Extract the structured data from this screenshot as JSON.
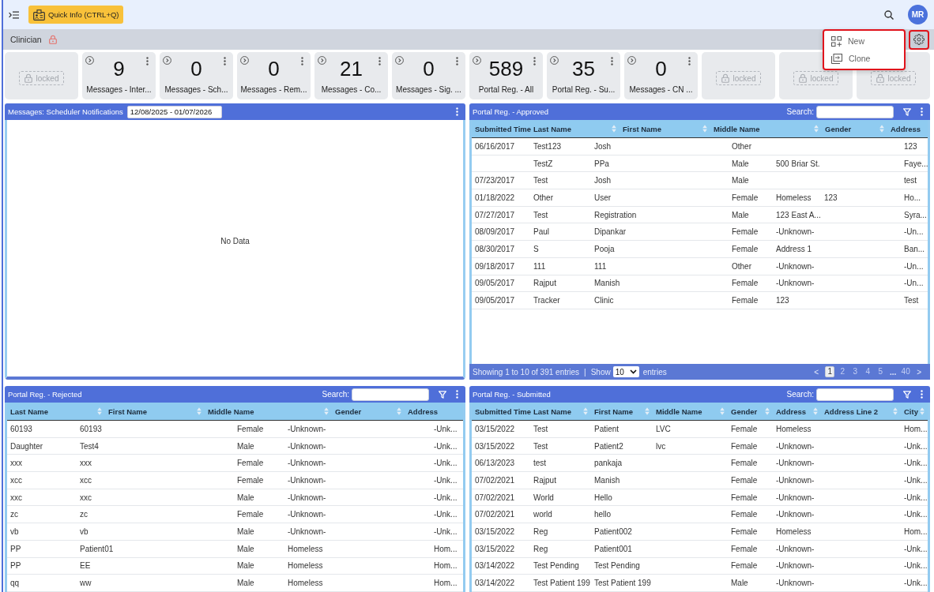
{
  "top_bar": {
    "quick_info": "Quick Info (CTRL+Q)",
    "avatar": "MR"
  },
  "role_bar": {
    "role": "Clinician",
    "locked": true,
    "settings_button": {
      "highlighted": true
    }
  },
  "settings_menu": {
    "open": true,
    "highlighted": true,
    "items": [
      {
        "kind": "new",
        "label": "New"
      },
      {
        "kind": "clone",
        "label": "Clone"
      }
    ]
  },
  "tiles": [
    {
      "kind": "locked",
      "label": "locked"
    },
    {
      "kind": "counter",
      "value": "9",
      "label": "Messages - Inter..."
    },
    {
      "kind": "counter",
      "value": "0",
      "label": "Messages - Sch..."
    },
    {
      "kind": "counter",
      "value": "0",
      "label": "Messages - Rem..."
    },
    {
      "kind": "counter",
      "value": "21",
      "label": "Messages - Co..."
    },
    {
      "kind": "counter",
      "value": "0",
      "label": "Messages - Sig. ..."
    },
    {
      "kind": "counter",
      "value": "589",
      "label": "Portal Reg. - All"
    },
    {
      "kind": "counter",
      "value": "35",
      "label": "Portal Reg. - Su..."
    },
    {
      "kind": "counter",
      "value": "0",
      "label": "Messages - CN ..."
    },
    {
      "kind": "locked",
      "label": "locked"
    },
    {
      "kind": "locked",
      "label": "locked"
    },
    {
      "kind": "locked",
      "label": "locked"
    }
  ],
  "scheduler_panel": {
    "title": "Messages: Scheduler Notifications",
    "date_range": "12/08/2025 - 01/07/2026",
    "empty_message": "No Data"
  },
  "approved_table": {
    "title": "Portal Reg. - Approved",
    "search_label": "Search:",
    "columns": [
      {
        "label": "Submitted Time",
        "sortable": false
      },
      {
        "label": "Last Name",
        "sortable": true
      },
      {
        "label": "First Name",
        "sortable": true
      },
      {
        "label": "Middle Name",
        "sortable": true
      },
      {
        "label": "Gender",
        "sortable": true
      },
      {
        "label": "Address",
        "sortable": false
      }
    ],
    "rows": [
      {
        "column_1": "06/16/2017",
        "column_2": "Test123",
        "column_3": "Josh",
        "column_4": "Other",
        "column_7": "123"
      },
      {
        "column_2": "TestZ",
        "column_3": "PPa",
        "column_4": "Male",
        "column_5": "500 Briar St.",
        "column_7": "Faye..."
      },
      {
        "column_1": "07/23/2017",
        "column_2": "Test",
        "column_3": "Josh",
        "column_4": "Male",
        "column_7": "test"
      },
      {
        "column_1": "01/18/2022",
        "column_2": "Other",
        "column_3": "User",
        "column_4": "Female",
        "column_5": "Homeless",
        "column_6": "123",
        "column_7": "Ho..."
      },
      {
        "column_1": "07/27/2017",
        "column_2": "Test",
        "column_3": "Registration",
        "column_4": "Male",
        "column_5": "123 East A...",
        "column_7": "Syra..."
      },
      {
        "column_1": "08/09/2017",
        "column_2": "Paul",
        "column_3": "Dipankar",
        "column_4": "Female",
        "column_5": "-Unknown-",
        "column_7": "-Un..."
      },
      {
        "column_1": "08/30/2017",
        "column_2": "S",
        "column_3": "Pooja",
        "column_4": "Female",
        "column_5": "Address 1",
        "column_7": "Ban..."
      },
      {
        "column_1": "09/18/2017",
        "column_2": "111",
        "column_3": "111",
        "column_4": "Other",
        "column_5": "-Unknown-",
        "column_7": "-Un..."
      },
      {
        "column_1": "09/05/2017",
        "column_2": "Rajput",
        "column_3": "Manish",
        "column_4": "Female",
        "column_5": "-Unknown-",
        "column_7": "-Un..."
      },
      {
        "column_1": "09/05/2017",
        "column_2": "Tracker",
        "column_3": "Clinic",
        "column_4": "Female",
        "column_5": "123",
        "column_7": "Test"
      }
    ],
    "footer": {
      "summary": "Showing 1 to 10 of 391 entries",
      "separator": "|",
      "show_label": "Show",
      "page_size": "10",
      "entries_label": "entries",
      "previous": "<",
      "pages": [
        {
          "kind": "page",
          "label": "1",
          "selected": true
        },
        {
          "kind": "page",
          "label": "2",
          "selected": false
        },
        {
          "kind": "page",
          "label": "3",
          "selected": false
        },
        {
          "kind": "page",
          "label": "4",
          "selected": false
        },
        {
          "kind": "page",
          "label": "5",
          "selected": false
        },
        {
          "kind": "gap",
          "label": "..."
        },
        {
          "kind": "page",
          "label": "40",
          "selected": false
        }
      ],
      "next": ">"
    }
  },
  "rejected_table": {
    "title": "Portal Reg. - Rejected",
    "search_label": "Search:",
    "columns": [
      {
        "label": "Last Name",
        "sortable": true
      },
      {
        "label": "First Name",
        "sortable": true
      },
      {
        "label": "Middle Name",
        "sortable": true
      },
      {
        "label": "Gender",
        "sortable": true
      },
      {
        "label": "Address",
        "sortable": false
      }
    ],
    "rows": [
      {
        "column_1": "60193",
        "column_2": "60193",
        "column_3": "Female",
        "column_4": "-Unknown-",
        "column_5": "-Unk..."
      },
      {
        "column_1": "Daughter",
        "column_2": "Test4",
        "column_3": "Male",
        "column_4": "-Unknown-",
        "column_5": "-Unk..."
      },
      {
        "column_1": "xxx",
        "column_2": "xxx",
        "column_3": "Female",
        "column_4": "-Unknown-",
        "column_5": "-Unk..."
      },
      {
        "column_1": "xcc",
        "column_2": "xcc",
        "column_3": "Female",
        "column_4": "-Unknown-",
        "column_5": "-Unk..."
      },
      {
        "column_1": "xxc",
        "column_2": "xxc",
        "column_3": "Male",
        "column_4": "-Unknown-",
        "column_5": "-Unk..."
      },
      {
        "column_1": "zc",
        "column_2": "zc",
        "column_3": "Female",
        "column_4": "-Unknown-",
        "column_5": "-Unk..."
      },
      {
        "column_1": "vb",
        "column_2": "vb",
        "column_3": "Male",
        "column_4": "-Unknown-",
        "column_5": "-Unk..."
      },
      {
        "column_1": "PP",
        "column_2": "Patient01",
        "column_3": "Male",
        "column_4": "Homeless",
        "column_5": "Hom..."
      },
      {
        "column_1": "PP",
        "column_2": "EE",
        "column_3": "Male",
        "column_4": "Homeless",
        "column_5": "Hom..."
      },
      {
        "column_1": "qq",
        "column_2": "ww",
        "column_3": "Male",
        "column_4": "Homeless",
        "column_5": "Hom..."
      }
    ]
  },
  "submitted_table": {
    "title": "Portal Reg. - Submitted",
    "search_label": "Search:",
    "columns": [
      {
        "label": "Submitted Time",
        "sortable": false
      },
      {
        "label": "Last Name",
        "sortable": true
      },
      {
        "label": "First Name",
        "sortable": true
      },
      {
        "label": "Middle Name",
        "sortable": true
      },
      {
        "label": "Gender",
        "sortable": true
      },
      {
        "label": "Address",
        "sortable": true
      },
      {
        "label": "Address Line 2",
        "sortable": true
      },
      {
        "label": "City",
        "sortable": true
      }
    ],
    "rows": [
      {
        "column_1": "03/15/2022",
        "column_2": "Test",
        "column_3": "Patient",
        "column_4": "LVC",
        "column_5": "Female",
        "column_6": "Homeless",
        "column_8": "Hom..."
      },
      {
        "column_1": "03/15/2022",
        "column_2": "Test",
        "column_3": "Patient2",
        "column_4": "lvc",
        "column_5": "Female",
        "column_6": "-Unknown-",
        "column_8": "-Unk..."
      },
      {
        "column_1": "06/13/2023",
        "column_2": "test",
        "column_3": "pankaja",
        "column_5": "Female",
        "column_6": "-Unknown-",
        "column_8": "-Unk..."
      },
      {
        "column_1": "07/02/2021",
        "column_2": "Rajput",
        "column_3": "Manish",
        "column_5": "Female",
        "column_6": "-Unknown-",
        "column_8": "-Unk..."
      },
      {
        "column_1": "07/02/2021",
        "column_2": "World",
        "column_3": "Hello",
        "column_5": "Female",
        "column_6": "-Unknown-",
        "column_8": "-Unk..."
      },
      {
        "column_1": "07/02/2021",
        "column_2": "world",
        "column_3": "hello",
        "column_5": "Female",
        "column_6": "-Unknown-",
        "column_8": "-Unk..."
      },
      {
        "column_1": "03/15/2022",
        "column_2": "Reg",
        "column_3": "Patient002",
        "column_5": "Female",
        "column_6": "Homeless",
        "column_8": "Hom..."
      },
      {
        "column_1": "03/15/2022",
        "column_2": "Reg",
        "column_3": "Patient001",
        "column_5": "Female",
        "column_6": "-Unknown-",
        "column_8": "-Unk..."
      },
      {
        "column_1": "03/14/2022",
        "column_2": "Test Pending",
        "column_3": "Test Pending",
        "column_5": "Female",
        "column_6": "-Unknown-",
        "column_8": "-Unk..."
      },
      {
        "column_1": "03/14/2022",
        "column_2": "Test Patient 199",
        "column_3": "Test Patient 199",
        "column_5": "Male",
        "column_6": "-Unknown-",
        "column_8": "-Unk..."
      }
    ]
  }
}
